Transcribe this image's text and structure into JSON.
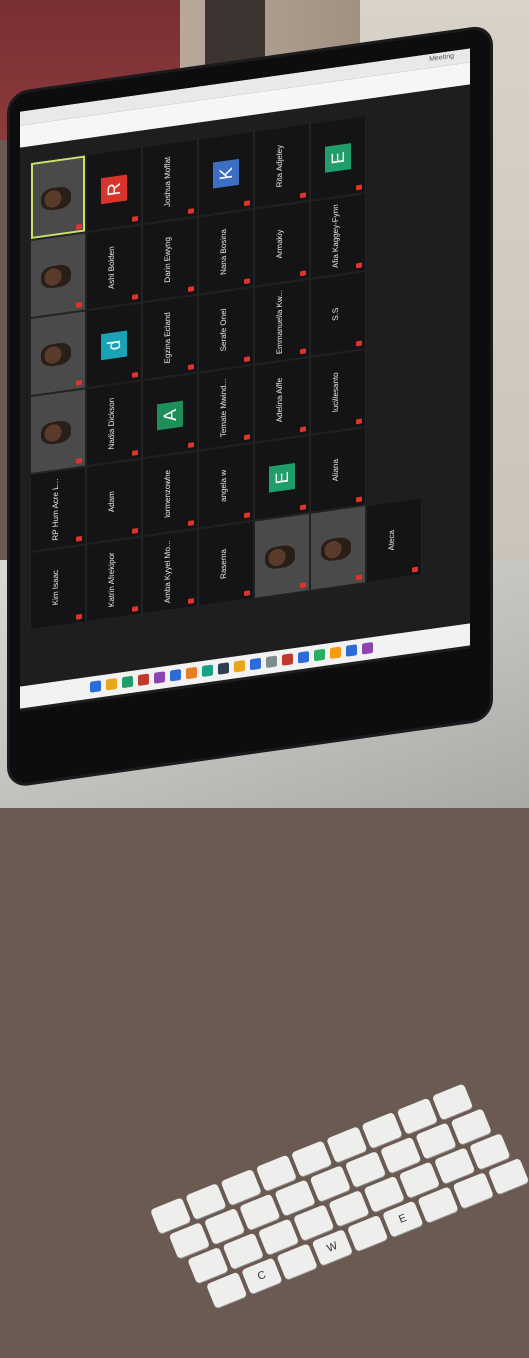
{
  "window": {
    "title": "Meeting"
  },
  "participants": [
    {
      "name": "Kim Isaac",
      "type": "name"
    },
    {
      "name": "RP Hum Acre L...",
      "type": "name"
    },
    {
      "name": "",
      "type": "video"
    },
    {
      "name": "",
      "type": "video"
    },
    {
      "name": "",
      "type": "video"
    },
    {
      "name": "",
      "type": "video",
      "active": true
    },
    {
      "name": "Katrin Afrekipor",
      "type": "name"
    },
    {
      "name": "Adam",
      "type": "name"
    },
    {
      "name": "Nadia Dickson",
      "type": "name"
    },
    {
      "name": "d",
      "type": "avatar",
      "color": "#1aa3b5"
    },
    {
      "name": "Ashl Bolden",
      "type": "name"
    },
    {
      "name": "R",
      "type": "avatar",
      "color": "#d9342b"
    },
    {
      "name": "Amba Kyyel Mo...",
      "type": "name"
    },
    {
      "name": "lormenzowhe",
      "type": "name"
    },
    {
      "name": "A",
      "type": "avatar",
      "color": "#1f8f5a"
    },
    {
      "name": "Egzina Ecland",
      "type": "name"
    },
    {
      "name": "Darin Ewyng",
      "type": "name"
    },
    {
      "name": "Joshua Moffat",
      "type": "name"
    },
    {
      "name": "Rasema",
      "type": "name"
    },
    {
      "name": "angela w",
      "type": "name"
    },
    {
      "name": "Temate Mwind...",
      "type": "name"
    },
    {
      "name": "Serafe Onel",
      "type": "name"
    },
    {
      "name": "Nana Bosina",
      "type": "name"
    },
    {
      "name": "K",
      "type": "avatar",
      "color": "#3c6fc4"
    },
    {
      "name": "",
      "type": "video"
    },
    {
      "name": "E",
      "type": "avatar",
      "color": "#1f9e6a"
    },
    {
      "name": "Adelina Aiffe",
      "type": "name"
    },
    {
      "name": "Emmanuella Kw...",
      "type": "name"
    },
    {
      "name": "Armakiy",
      "type": "name"
    },
    {
      "name": "Rita Adjeley",
      "type": "name"
    },
    {
      "name": "",
      "type": "video"
    },
    {
      "name": "Aliana",
      "type": "name"
    },
    {
      "name": "lucillesanto",
      "type": "name"
    },
    {
      "name": "S.S",
      "type": "name"
    },
    {
      "name": "Afia Kaggey-Fynn",
      "type": "name"
    },
    {
      "name": "E",
      "type": "avatar",
      "color": "#1f9e6a"
    },
    {
      "name": "Ateca",
      "type": "name"
    }
  ],
  "keyboard": {
    "keys": [
      "C",
      "W",
      "E"
    ]
  }
}
